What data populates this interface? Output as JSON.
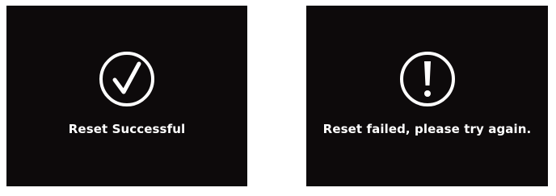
{
  "success_panel": {
    "icon": "check-circle-icon",
    "message": "Reset Successful"
  },
  "failure_panel": {
    "icon": "exclamation-circle-icon",
    "message": "Reset failed, please try again."
  },
  "colors": {
    "panel_background": "#0d0a0b",
    "foreground": "#ffffff",
    "page_background": "#ffffff"
  }
}
